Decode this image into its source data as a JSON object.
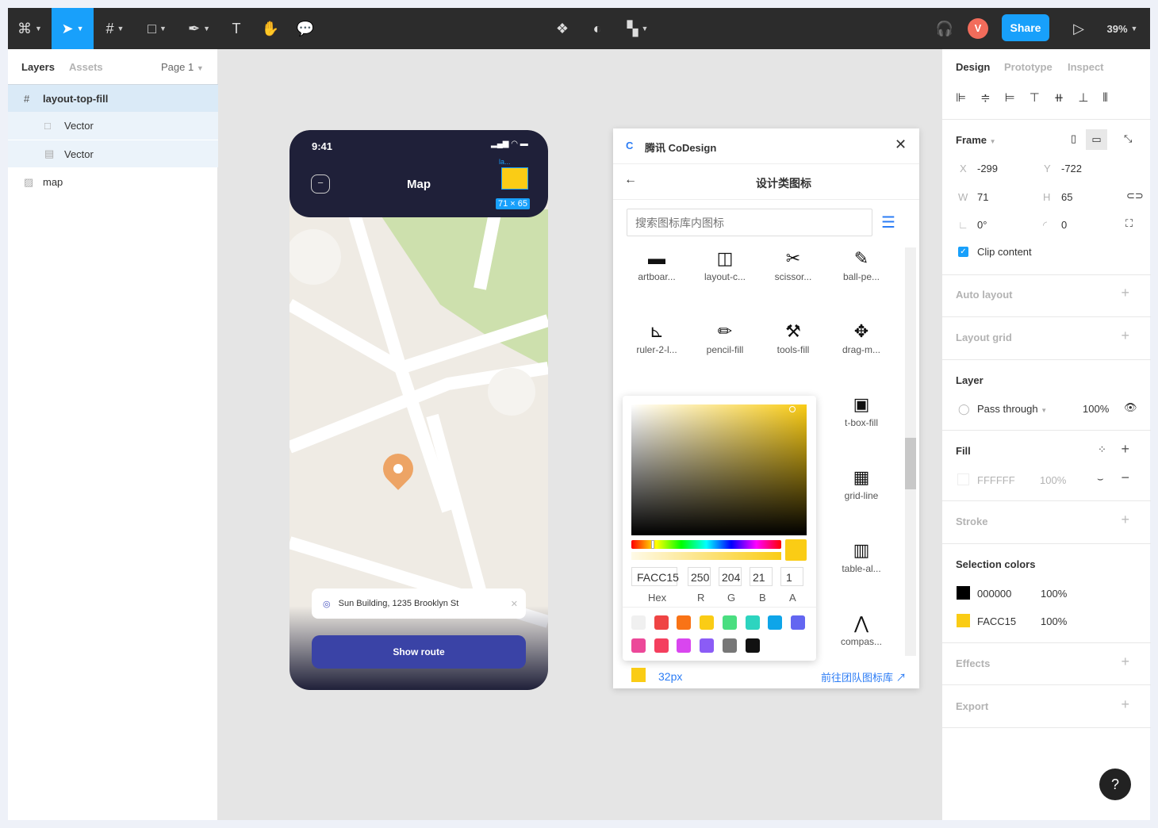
{
  "toolbar": {
    "zoom": "39%",
    "share": "Share",
    "avatar": "V"
  },
  "left": {
    "tabs": [
      "Layers",
      "Assets"
    ],
    "page": "Page 1",
    "layers": [
      "layout-top-fill",
      "Vector",
      "Vector",
      "map"
    ]
  },
  "phone": {
    "time": "9:41",
    "title": "Map",
    "selection_label": "la...",
    "size_badge": "71 × 65",
    "address": "Sun Building, 1235 Brooklyn St",
    "button": "Show route"
  },
  "plugin": {
    "title": "腾讯 CoDesign",
    "subtitle": "设计类图标",
    "search_placeholder": "搜索图标库内图标",
    "icons": [
      {
        "g": "▬",
        "label": "artboar..."
      },
      {
        "g": "◫",
        "label": "layout-c..."
      },
      {
        "g": "✂",
        "label": "scissor..."
      },
      {
        "g": "✎",
        "label": "ball-pe..."
      },
      {
        "g": "⊾",
        "label": "ruler-2-l..."
      },
      {
        "g": "✏",
        "label": "pencil-fill"
      },
      {
        "g": "⚒",
        "label": "tools-fill"
      },
      {
        "g": "✥",
        "label": "drag-m..."
      },
      {
        "g": "▣",
        "label": "t-box-fill"
      },
      {
        "g": "▦",
        "label": "grid-line"
      },
      {
        "g": "▥",
        "label": "table-al..."
      },
      {
        "g": "⋀",
        "label": "compas..."
      }
    ],
    "picker": {
      "hex": "FACC15",
      "r": "250",
      "g": "204",
      "b": "21",
      "a": "1",
      "labels": [
        "Hex",
        "R",
        "G",
        "B",
        "A"
      ],
      "swatches": [
        "#f0f0f0",
        "#ef4444",
        "#f97316",
        "#facc15",
        "#4ade80",
        "#2dd4bf",
        "#0ea5e9",
        "#6366f1",
        "#ec4899",
        "#f43f5e",
        "#d946ef",
        "#8b5cf6",
        "#777777",
        "#111111"
      ]
    },
    "size": "32px",
    "team_link": "前往团队图标库"
  },
  "right": {
    "tabs": [
      "Design",
      "Prototype",
      "Inspect"
    ],
    "frame": "Frame",
    "x_label": "X",
    "x": "-299",
    "y_label": "Y",
    "y": "-722",
    "w_label": "W",
    "w": "71",
    "h_label": "H",
    "h": "65",
    "rotation": "0°",
    "radius": "0",
    "clip": "Clip content",
    "auto_layout": "Auto layout",
    "layout_grid": "Layout grid",
    "layer": "Layer",
    "blend": "Pass through",
    "opacity": "100%",
    "fill": "Fill",
    "fill_hex": "FFFFFF",
    "fill_opacity": "100%",
    "stroke": "Stroke",
    "selection_colors": "Selection colors",
    "sel": [
      {
        "hex": "000000",
        "op": "100%",
        "color": "#000000"
      },
      {
        "hex": "FACC15",
        "op": "100%",
        "color": "#FACC15"
      }
    ],
    "effects": "Effects",
    "export": "Export",
    "help": "?"
  }
}
